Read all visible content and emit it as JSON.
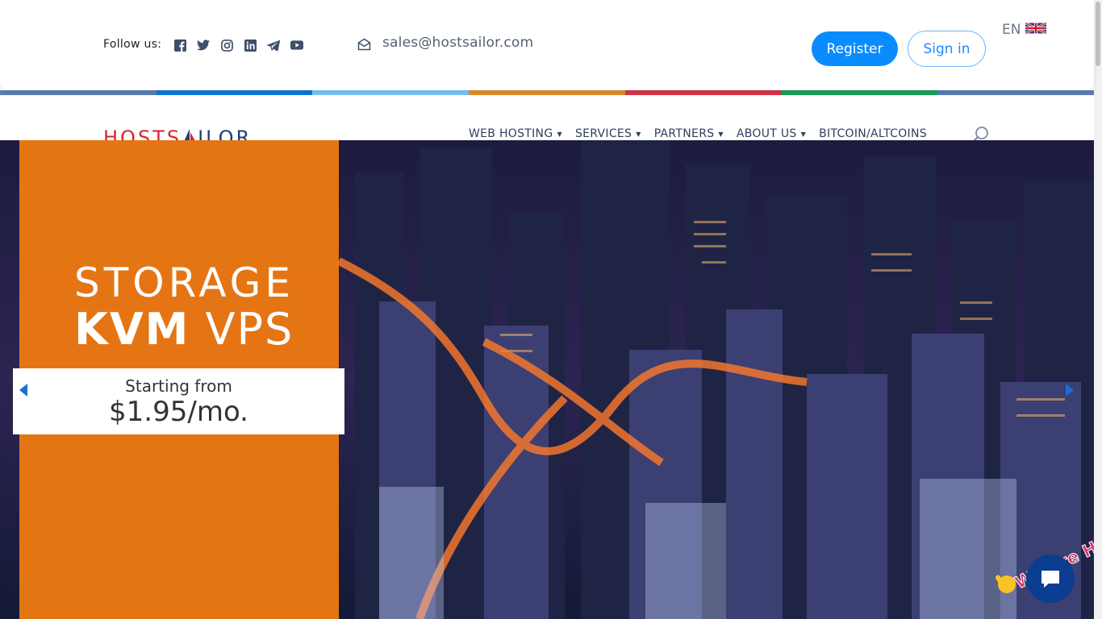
{
  "topbar": {
    "follow_label": "Follow us:",
    "social_icons": [
      "facebook-icon",
      "twitter-icon",
      "instagram-icon",
      "linkedin-icon",
      "telegram-icon",
      "youtube-icon"
    ],
    "email": "sales@hostsailor.com",
    "register_label": "Register",
    "signin_label": "Sign in",
    "language": "EN"
  },
  "stripe_colors": [
    "#5b7db5",
    "#0a7ad6",
    "#7cc4f7",
    "#e08e2b",
    "#d8344a",
    "#16a05a",
    "#5b7db5"
  ],
  "logo": {
    "part1": "HOSTS",
    "part2": "ILOR",
    "color1": "#d8262e",
    "color2": "#1c3f7a"
  },
  "nav": {
    "items": [
      {
        "label": "WEB HOSTING",
        "has_caret": true
      },
      {
        "label": "SERVICES",
        "has_caret": true
      },
      {
        "label": "PARTNERS",
        "has_caret": true
      },
      {
        "label": "ABOUT US",
        "has_caret": true
      },
      {
        "label": "BITCOIN/ALTCOINS",
        "has_caret": false
      }
    ]
  },
  "hero": {
    "line1": "STORAGE",
    "line2_bold": "KVM",
    "line2_rest": "VPS",
    "starting": "Starting from",
    "price": "$1.95/mo."
  },
  "chat": {
    "badge_text": "We Are Here!"
  },
  "colors": {
    "accent": "#0a8cff",
    "orange": "#f57d0f",
    "nav_text": "#2e3f5e"
  }
}
